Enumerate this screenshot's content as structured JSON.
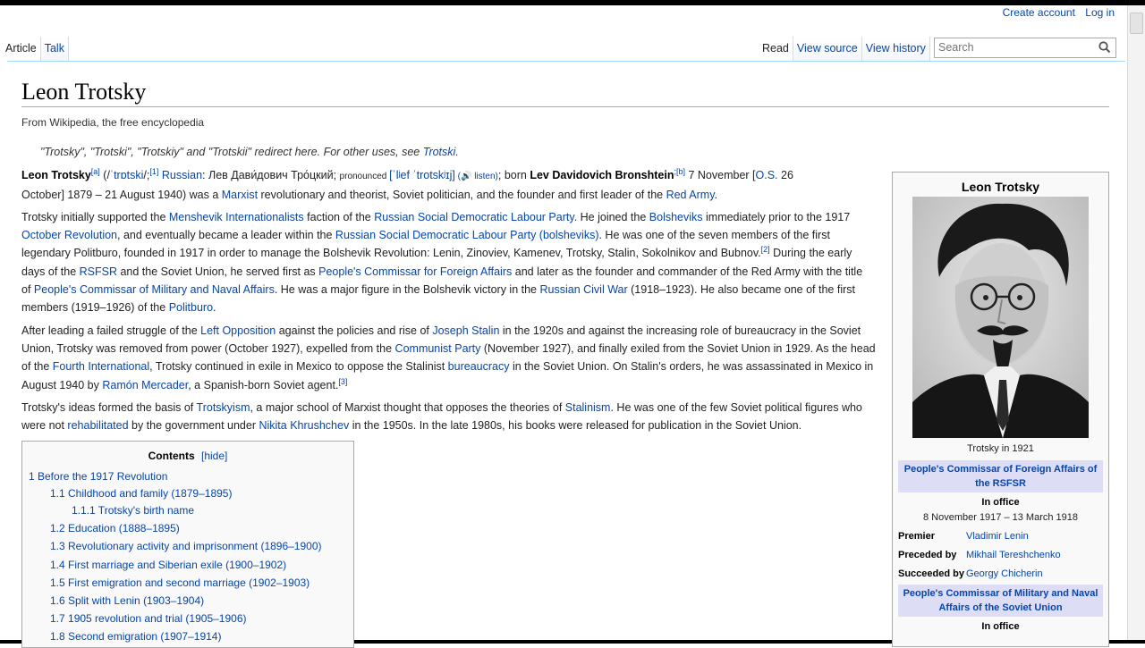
{
  "personal": {
    "create_account": "Create account",
    "log_in": "Log in"
  },
  "tabs": {
    "article": "Article",
    "talk": "Talk",
    "read": "Read",
    "view_source": "View source",
    "view_history": "View history"
  },
  "search": {
    "placeholder": "Search"
  },
  "article": {
    "title": "Leon Trotsky",
    "tagline": "From Wikipedia, the free encyclopedia",
    "hatnote_pre": "\"Trotsky\", \"Trotski\", \"Trotskiy\" and \"Trotskii\" redirect here. For other uses, see ",
    "hatnote_link": "Trotski",
    "hatnote_post": ".",
    "p1": {
      "name": "Leon Trotsky",
      "sup_a": "[a]",
      "ipa_open": " (/",
      "ipa": "ˈtrɒtski",
      "ipa_close": "/;",
      "sup1": "[1]",
      "russian": "Russian",
      "russian_text": ": Лев Дави́дович Тро́цкий; ",
      "pronounced": "pronounced ",
      "ipa2": "[ˈlʲef ˈtrotskʲɪj]",
      "listen": " (🔊 listen)",
      "born": "; born ",
      "birthname": "Lev Davidovich Bronshtein",
      "sup_b": ";[b]",
      "date1": " 7 November [",
      "os": "O.S.",
      "date2": " 26",
      "line2_a": "October] 1879 – 21 August 1940) was a ",
      "marxist": "Marxist",
      "line2_b": " revolutionary and theorist, Soviet politician, and the founder and first leader of the ",
      "red_army": "Red Army",
      "line2_c": "."
    },
    "p2": {
      "a": "Trotsky initially supported the ",
      "l1": "Menshevik Internationalists",
      "b": " faction of the ",
      "l2": "Russian Social Democratic Labour Party",
      "c": ". He joined the ",
      "l3": "Bolsheviks",
      "d": " immediately prior to the 1917 ",
      "l4": "October Revolution",
      "e": ", and eventually became a leader within the ",
      "l5": "Russian Social Democratic Labour Party (bolsheviks)",
      "f": ". He was one of the seven members of the first legendary Politburo, founded in 1917 in order to manage the Bolshevik Revolution: Lenin, Zinoviev, Kamenev, Trotsky, Stalin, Sokolnikov and Bubnov.",
      "sup2": "[2]",
      "g": " During the early days of the ",
      "l6": "RSFSR",
      "h": " and the Soviet Union, he served first as ",
      "l7": "People's Commissar for Foreign Affairs",
      "i": " and later as the founder and commander of the Red Army with the title of ",
      "l8": "People's Commissar of Military and Naval Affairs",
      "j": ". He was a major figure in the Bolshevik victory in the ",
      "l9": "Russian Civil War",
      "k": " (1918–1923). He also became one of the first members (1919–1926) of the ",
      "l10": "Politburo",
      "m": "."
    },
    "p3": {
      "a": "After leading a failed struggle of the ",
      "l1": "Left Opposition",
      "b": " against the policies and rise of ",
      "l2": "Joseph Stalin",
      "c": " in the 1920s and against the increasing role of bureaucracy in the Soviet Union, Trotsky was removed from power (October 1927), expelled from the ",
      "l3": "Communist Party",
      "d": " (November 1927), and finally exiled from the Soviet Union in 1929. As the head of the ",
      "l4": "Fourth International",
      "e": ", Trotsky continued in exile in Mexico to oppose the Stalinist ",
      "l5": "bureaucracy",
      "f": " in the Soviet Union. On Stalin's orders, he was assassinated in Mexico in August 1940 by ",
      "l6": "Ramón Mercader",
      "g": ", a Spanish-born Soviet agent.",
      "sup3": "[3]"
    },
    "p4": {
      "a": "Trotsky's ideas formed the basis of ",
      "l1": "Trotskyism",
      "b": ", a major school of Marxist thought that opposes the theories of ",
      "l2": "Stalinism",
      "c": ". He was one of the few Soviet political figures who were not ",
      "l3": "rehabilitated",
      "d": " by the government under ",
      "l4": "Nikita Khrushchev",
      "e": " in the 1950s. In the late 1980s, his books were released for publication in the Soviet Union."
    }
  },
  "toc": {
    "title": "Contents",
    "toggle": "[hide]",
    "items": [
      "1 Before the 1917 Revolution",
      "1.1 Childhood and family (1879–1895)",
      "1.1.1 Trotsky's birth name",
      "1.2 Education (1888–1895)",
      "1.3 Revolutionary activity and imprisonment (1896–1900)",
      "1.4 First marriage and Siberian exile (1900–1902)",
      "1.5 First emigration and second marriage (1902–1903)",
      "1.6 Split with Lenin (1903–1904)",
      "1.7 1905 revolution and trial (1905–1906)",
      "1.8 Second emigration (1907–1914)"
    ]
  },
  "infobox": {
    "title": "Leon Trotsky",
    "caption": "Trotsky in 1921",
    "office1": "People's Commissar of Foreign Affairs of the RSFSR",
    "in_office1": "In office",
    "term1": "8 November 1917 – 13 March 1918",
    "premier_label": "Premier",
    "premier_value": "Vladimir Lenin",
    "preceded_label": "Preceded by",
    "preceded_value": "Mikhail Tereshchenko",
    "succeeded_label": "Succeeded by",
    "succeeded_value": "Georgy Chicherin",
    "office2": "People's Commissar of Military and Naval Affairs of the Soviet Union",
    "in_office2": "In office"
  }
}
